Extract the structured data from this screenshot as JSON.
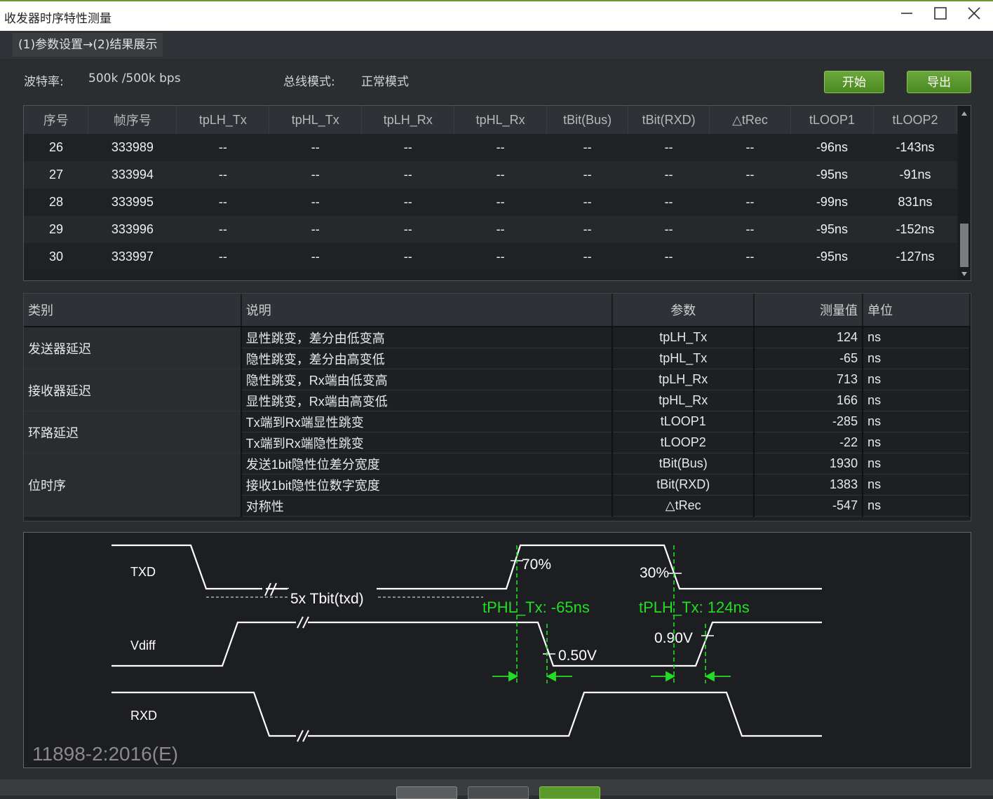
{
  "window": {
    "title": "收发器时序特性测量"
  },
  "breadcrumb": "(1)参数设置→(2)结果展示",
  "info": {
    "baud_label": "波特率:",
    "baud_value": "500k /500k bps",
    "bus_label": "总线模式:",
    "bus_value": "正常模式"
  },
  "buttons": {
    "start": "开始",
    "export": "导出"
  },
  "frame_table": {
    "headers": [
      "序号",
      "帧序号",
      "tpLH_Tx",
      "tpHL_Tx",
      "tpLH_Rx",
      "tpHL_Rx",
      "tBit(Bus)",
      "tBit(RXD)",
      "△tRec",
      "tLOOP1",
      "tLOOP2"
    ],
    "rows": [
      [
        "26",
        "333989",
        "--",
        "--",
        "--",
        "--",
        "--",
        "--",
        "--",
        "-96ns",
        "-143ns"
      ],
      [
        "27",
        "333994",
        "--",
        "--",
        "--",
        "--",
        "--",
        "--",
        "--",
        "-95ns",
        "-91ns"
      ],
      [
        "28",
        "333995",
        "--",
        "--",
        "--",
        "--",
        "--",
        "--",
        "--",
        "-99ns",
        "831ns"
      ],
      [
        "29",
        "333996",
        "--",
        "--",
        "--",
        "--",
        "--",
        "--",
        "--",
        "-95ns",
        "-152ns"
      ],
      [
        "30",
        "333997",
        "--",
        "--",
        "--",
        "--",
        "--",
        "--",
        "--",
        "-95ns",
        "-127ns"
      ]
    ]
  },
  "result_table": {
    "headers": [
      "类别",
      "说明",
      "参数",
      "测量值",
      "单位"
    ],
    "categories": [
      "发送器延迟",
      "接收器延迟",
      "环路延迟",
      "位时序"
    ],
    "rows": [
      [
        "显性跳变，差分由低变高",
        "tpLH_Tx",
        "124",
        "ns"
      ],
      [
        "隐性跳变，差分由高变低",
        "tpHL_Tx",
        "-65",
        "ns"
      ],
      [
        "隐性跳变，Rx端由低变高",
        "tpLH_Rx",
        "713",
        "ns"
      ],
      [
        "显性跳变，Rx端由高变低",
        "tpHL_Rx",
        "166",
        "ns"
      ],
      [
        "Tx端到Rx端显性跳变",
        "tLOOP1",
        "-285",
        "ns"
      ],
      [
        "Tx端到Rx端隐性跳变",
        "tLOOP2",
        "-22",
        "ns"
      ],
      [
        "发送1bit隐性位差分宽度",
        "tBit(Bus)",
        "1930",
        "ns"
      ],
      [
        "接收1bit隐性位数字宽度",
        "tBit(RXD)",
        "1383",
        "ns"
      ],
      [
        "对称性",
        "△tRec",
        "-547",
        "ns"
      ]
    ]
  },
  "diagram": {
    "signals": [
      "TXD",
      "Vdiff",
      "RXD"
    ],
    "label_70": "70%",
    "label_30": "30%",
    "label_050": "0.50V",
    "label_090": "0.90V",
    "label_5x": "5x Tbit(txd)",
    "tphl_label": "tPHL_Tx: -65ns",
    "tplh_label": "tPLH_Tx: 124ns",
    "watermark": "11898-2:2016(E)",
    "colors": {
      "green": "#22dd22",
      "line": "#ffffff"
    }
  }
}
